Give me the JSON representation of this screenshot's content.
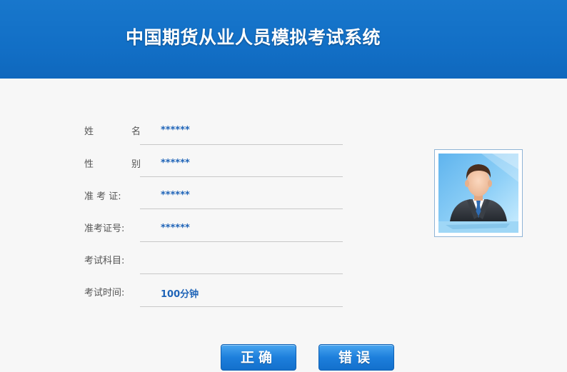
{
  "header": {
    "title": "中国期货从业人员模拟考试系统"
  },
  "form": {
    "name": {
      "label_first": "姓",
      "label_last": "名",
      "value": "******"
    },
    "gender": {
      "label_first": "性",
      "label_last": "别",
      "value": "******"
    },
    "admission_ticket": {
      "label": "准 考 证:",
      "value": "******"
    },
    "ticket_number": {
      "label": "准考证号:",
      "value": "******"
    },
    "subject": {
      "label": "考试科目:",
      "value": ""
    },
    "duration": {
      "label": "考试时间:",
      "value": "100分钟"
    }
  },
  "photo": {
    "icon": "person-avatar-icon"
  },
  "buttons": {
    "correct": "正确",
    "wrong": "错误"
  }
}
